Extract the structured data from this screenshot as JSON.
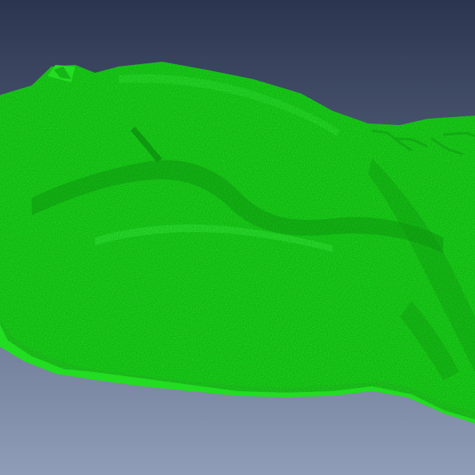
{
  "scene": {
    "background_top_color": "#2b3550",
    "background_bottom_color": "#8f9db8",
    "mesh_color": "#1ee61e",
    "mesh_highlight_color": "#36ff3a",
    "mesh_shadow_color": "#10a514",
    "mesh_side_color": "#22dd22"
  }
}
